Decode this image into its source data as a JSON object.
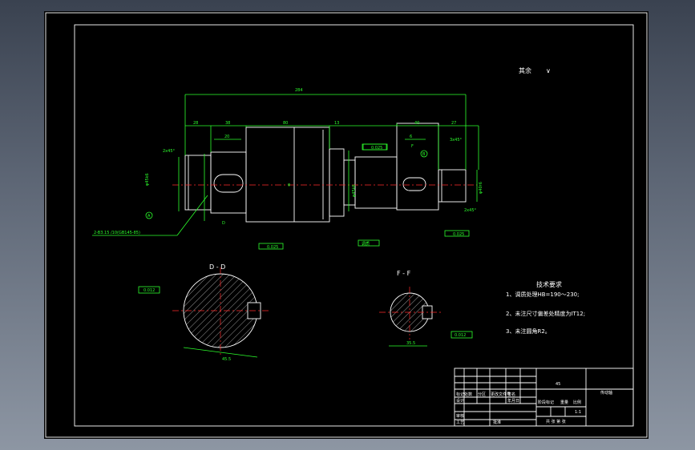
{
  "roughness_note": "其余",
  "roughness_symbol": "∨",
  "dimensions": {
    "overall": "284",
    "d1": "28",
    "d2": "38",
    "d3": "80",
    "d4": "13",
    "d5": "40",
    "d6": "27",
    "d7": "20",
    "d8": "6",
    "chamfer_left": "2x45°",
    "chamfer_right": "2x45°",
    "thread_right": "3x45°",
    "phi_left": "φ45k6",
    "phi_mid": "φ",
    "phi_r1": "φ45k6",
    "phi_r2": "φ40r6",
    "d_label": "D",
    "f_label": "F",
    "tol1": "0.025",
    "tol2": "0.025",
    "tol3": "0.025",
    "tol4": "0.025",
    "center_hole": "2-B3.15 /10(GB145-85)",
    "ref_a": "A",
    "ref_b": "B",
    "note_box": "调质"
  },
  "section_dd": {
    "title": "D - D",
    "tol": "0.012",
    "dim": "45.5"
  },
  "section_ff": {
    "title": "F - F",
    "tol": "0.012",
    "dim": "35.5"
  },
  "requirements": {
    "title": "技术要求",
    "items": [
      "1、调质处理HB=190～230;",
      "2、未注尺寸偏差处精度为IT12;",
      "3、未注圆角R2。"
    ]
  },
  "title_block": {
    "material": "45",
    "part_name": "传动轴",
    "scale": "1:1",
    "col_a": "标记处数",
    "col_b": "分区",
    "col_c": "更改文件号",
    "col_d": "签名",
    "col_e": "年月日",
    "design": "设计",
    "check": "审核",
    "process": "工艺",
    "approve": "批准",
    "stage": "阶段标记",
    "weight": "重量",
    "ratio": "比例",
    "sheets": "共 张 第 张"
  }
}
